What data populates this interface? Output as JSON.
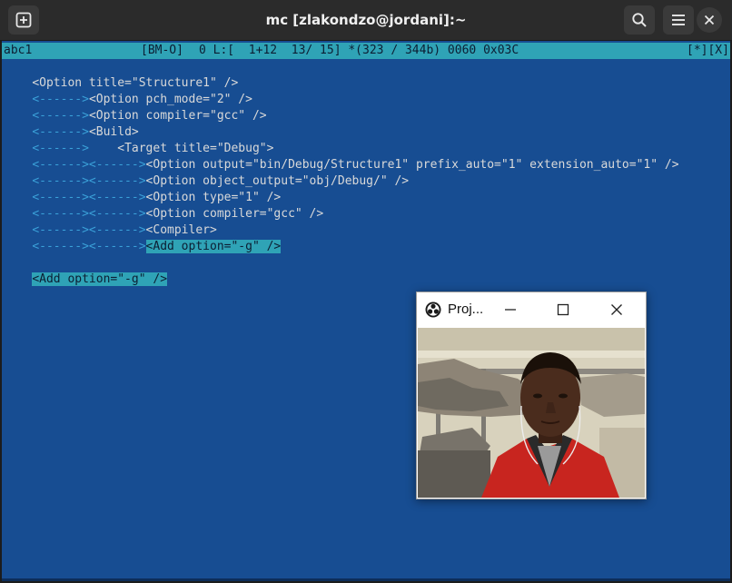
{
  "window": {
    "title": "mc [zlakondzo@jordani]:~"
  },
  "header_buttons": {
    "new_tab_icon": "new-tab-icon",
    "search_icon": "search-icon",
    "menu_icon": "hamburger-menu-icon",
    "close_icon": "close-icon"
  },
  "editor": {
    "status": {
      "filename": "abc1",
      "mode": "[BM-O]",
      "position": "0 L:[  1+12  13/ 15] *(323 / 344b) 0060 0x03C",
      "flags": "[*][X]"
    },
    "lines": [
      {
        "tabs": "",
        "text": "<Option title=\"Structure1\" />"
      },
      {
        "tabs": "<------>",
        "text": "<Option pch_mode=\"2\" />"
      },
      {
        "tabs": "<------>",
        "text": "<Option compiler=\"gcc\" />"
      },
      {
        "tabs": "<------>",
        "text": "<Build>"
      },
      {
        "tabs": "<------>",
        "text": "    <Target title=\"Debug\">"
      },
      {
        "tabs": "<------><------>",
        "text": "<Option output=\"bin/Debug/Structure1\" prefix_auto=\"1\" extension_auto=\"1\" />"
      },
      {
        "tabs": "<------><------>",
        "text": "<Option object_output=\"obj/Debug/\" />"
      },
      {
        "tabs": "<------><------>",
        "text": "<Option type=\"1\" />"
      },
      {
        "tabs": "<------><------>",
        "text": "<Option compiler=\"gcc\" />"
      },
      {
        "tabs": "<------><------>",
        "text": "<Compiler>"
      },
      {
        "tabs": "<------><------>",
        "text": "<Add option=\"-g\" />"
      },
      {
        "tabs": "",
        "text": ""
      },
      {
        "tabs": "",
        "text": "<Add option=\"-g\" />"
      }
    ]
  },
  "projector": {
    "title": "Proj...",
    "app_icon": "obs-icon",
    "controls": {
      "minimize": "minimize-icon",
      "maximize": "maximize-icon",
      "close": "close-icon"
    }
  },
  "colors": {
    "terminal_bg": "#174d92",
    "status_bg": "#2fa3b6",
    "tab_marker": "#3aa0d8",
    "header_bg": "#2b2b2b"
  }
}
